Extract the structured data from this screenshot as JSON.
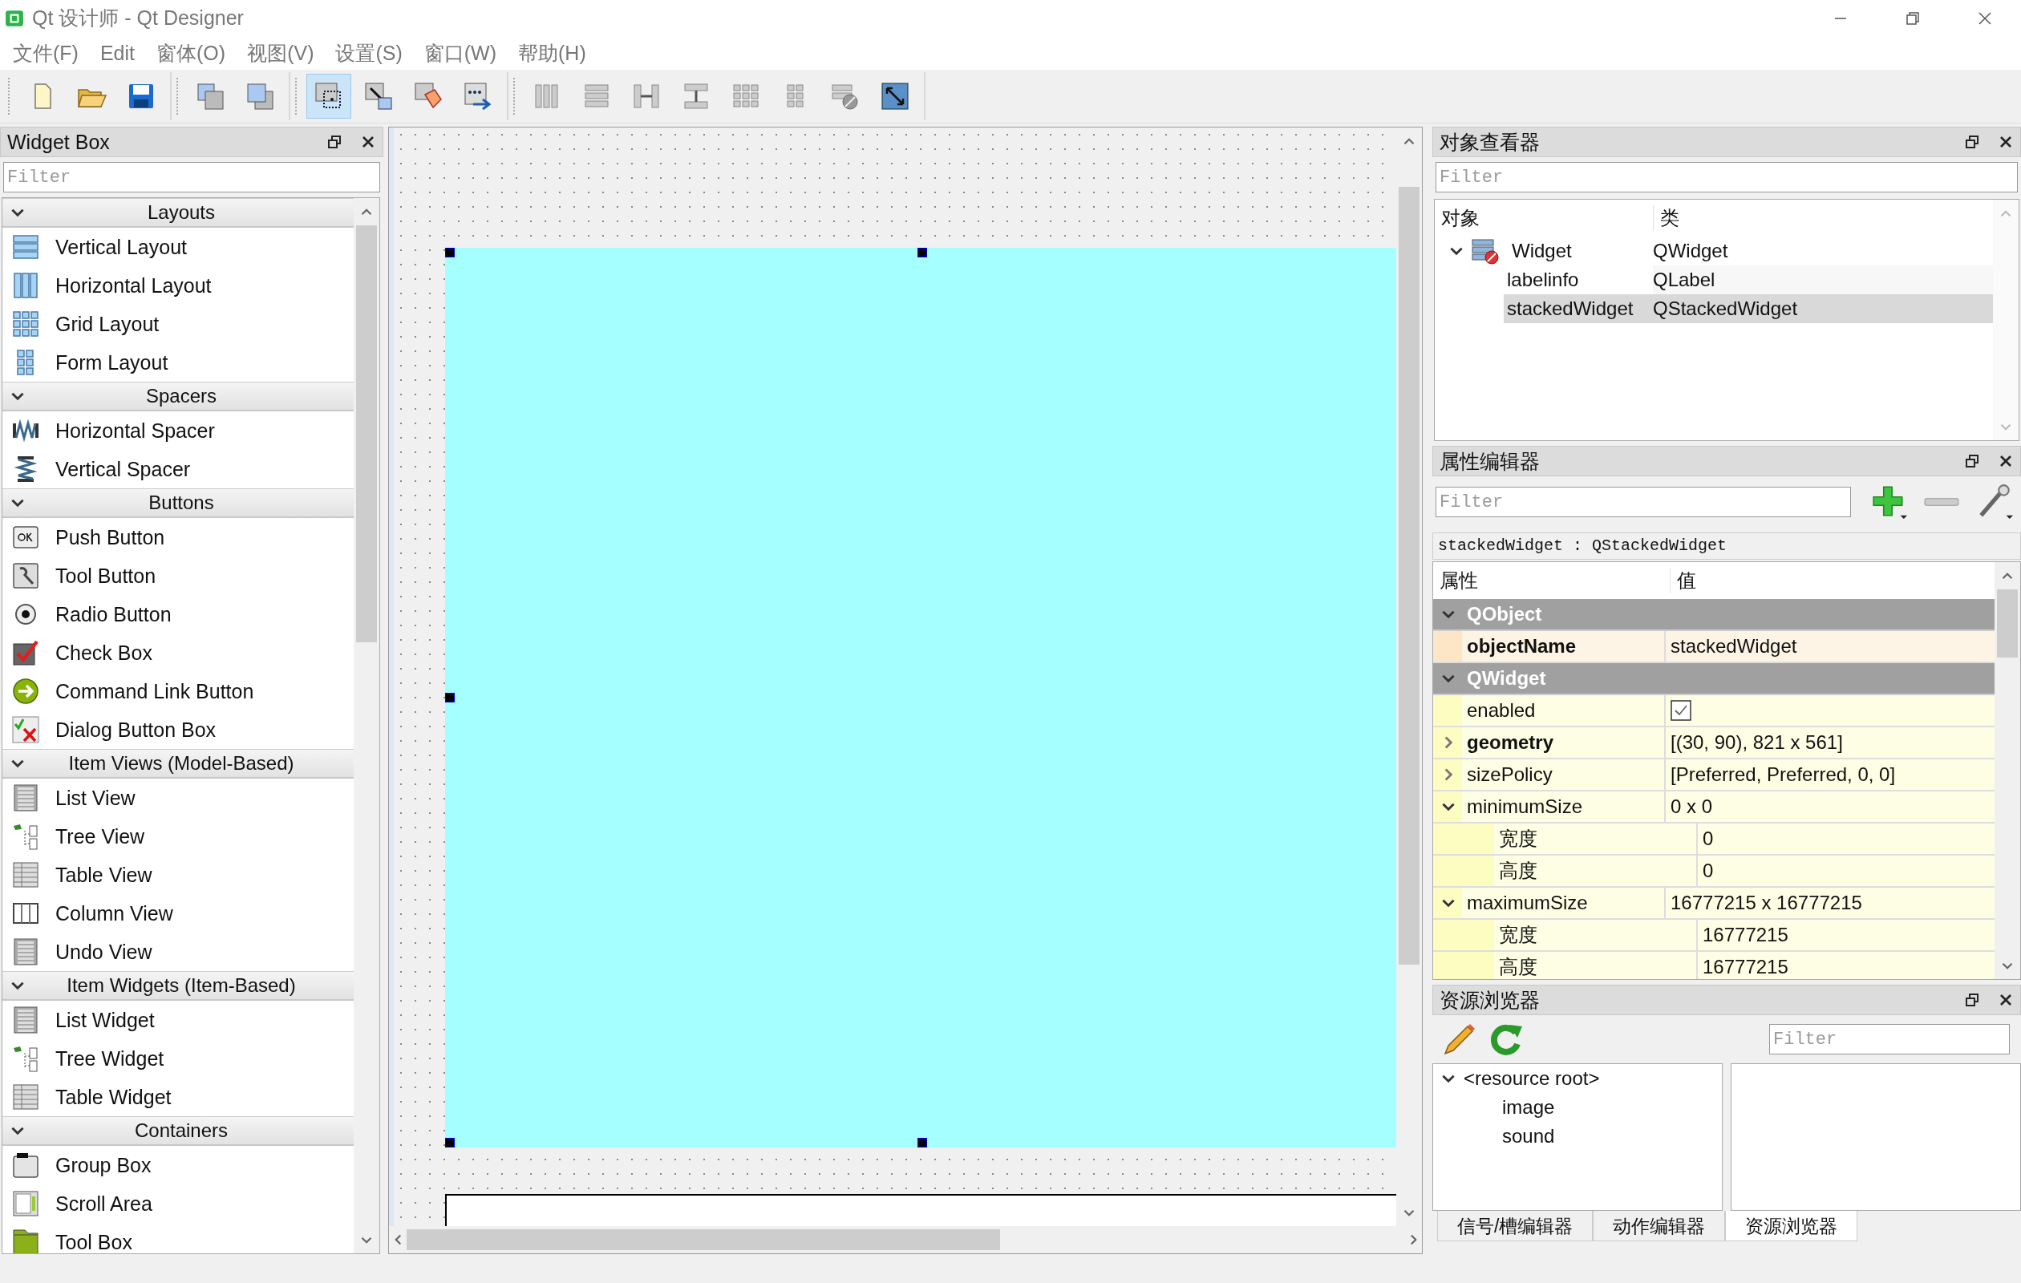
{
  "window": {
    "title": "Qt 设计师 - Qt Designer"
  },
  "menu": [
    "文件(F)",
    "Edit",
    "窗体(O)",
    "视图(V)",
    "设置(S)",
    "窗口(W)",
    "帮助(H)"
  ],
  "toolbar": {
    "groups": [
      {
        "buttons": [
          {
            "kind": "new",
            "selected": false
          },
          {
            "kind": "open",
            "selected": false
          },
          {
            "kind": "save",
            "selected": false
          }
        ]
      },
      {
        "buttons": [
          {
            "kind": "front",
            "selected": false
          },
          {
            "kind": "back",
            "selected": false
          }
        ]
      },
      {
        "buttons": [
          {
            "kind": "editwidgets",
            "selected": true
          },
          {
            "kind": "signals",
            "selected": false
          },
          {
            "kind": "buddy",
            "selected": false
          },
          {
            "kind": "taborder",
            "selected": false
          }
        ]
      },
      {
        "buttons": [
          {
            "kind": "hlayout",
            "selected": false
          },
          {
            "kind": "vlayout",
            "selected": false
          },
          {
            "kind": "hsplit",
            "selected": false
          },
          {
            "kind": "vsplit",
            "selected": false
          },
          {
            "kind": "grid",
            "selected": false
          },
          {
            "kind": "form",
            "selected": false
          },
          {
            "kind": "breaklayout",
            "selected": false
          },
          {
            "kind": "adjust",
            "selected": false
          }
        ]
      }
    ]
  },
  "widget_box": {
    "title": "Widget Box",
    "filter_placeholder": "Filter",
    "categories": [
      {
        "title": "Layouts",
        "expanded": true,
        "items": [
          {
            "label": "Vertical Layout",
            "kind": "vlayout"
          },
          {
            "label": "Horizontal Layout",
            "kind": "hlayout"
          },
          {
            "label": "Grid Layout",
            "kind": "grid"
          },
          {
            "label": "Form Layout",
            "kind": "form"
          }
        ]
      },
      {
        "title": "Spacers",
        "expanded": true,
        "items": [
          {
            "label": "Horizontal Spacer",
            "kind": "hspacer"
          },
          {
            "label": "Vertical Spacer",
            "kind": "vspacer"
          }
        ]
      },
      {
        "title": "Buttons",
        "expanded": true,
        "items": [
          {
            "label": "Push Button",
            "kind": "pushbutton"
          },
          {
            "label": "Tool Button",
            "kind": "toolbutton"
          },
          {
            "label": "Radio Button",
            "kind": "radio"
          },
          {
            "label": "Check Box",
            "kind": "checkbox"
          },
          {
            "label": "Command Link Button",
            "kind": "commandlink"
          },
          {
            "label": "Dialog Button Box",
            "kind": "dialogbuttons"
          }
        ]
      },
      {
        "title": "Item Views (Model-Based)",
        "expanded": true,
        "items": [
          {
            "label": "List View",
            "kind": "list"
          },
          {
            "label": "Tree View",
            "kind": "tree"
          },
          {
            "label": "Table View",
            "kind": "table"
          },
          {
            "label": "Column View",
            "kind": "column"
          },
          {
            "label": "Undo View",
            "kind": "list"
          }
        ]
      },
      {
        "title": "Item Widgets (Item-Based)",
        "expanded": true,
        "items": [
          {
            "label": "List Widget",
            "kind": "list"
          },
          {
            "label": "Tree Widget",
            "kind": "tree"
          },
          {
            "label": "Table Widget",
            "kind": "table"
          }
        ]
      },
      {
        "title": "Containers",
        "expanded": true,
        "items": [
          {
            "label": "Group Box",
            "kind": "group"
          },
          {
            "label": "Scroll Area",
            "kind": "scroll"
          },
          {
            "label": "Tool Box",
            "kind": "toolbox"
          }
        ]
      }
    ]
  },
  "object_inspector": {
    "title": "对象查看器",
    "filter_placeholder": "Filter",
    "columns": [
      "对象",
      "类"
    ],
    "objects": [
      {
        "name": "Widget",
        "class": "QWidget",
        "expanded": true,
        "selected": false,
        "children": [
          {
            "name": "labelinfo",
            "class": "QLabel",
            "selected": false
          },
          {
            "name": "stackedWidget",
            "class": "QStackedWidget",
            "selected": true
          }
        ]
      }
    ]
  },
  "property_editor": {
    "title": "属性编辑器",
    "filter_placeholder": "Filter",
    "object_line": "stackedWidget : QStackedWidget",
    "columns": [
      "属性",
      "值"
    ],
    "sections": [
      {
        "title": "QObject",
        "expanded": true,
        "color": "#fde6c6",
        "properties": [
          {
            "name": "objectName",
            "value": "stackedWidget",
            "bold": true
          }
        ]
      },
      {
        "title": "QWidget",
        "expanded": true,
        "color": "#fdfdc2",
        "properties": [
          {
            "name": "enabled",
            "kind": "bool",
            "checked": true,
            "bold": false
          },
          {
            "name": "geometry",
            "value": "[(30, 90), 821 x 561]",
            "bold": true,
            "expanded": false
          },
          {
            "name": "sizePolicy",
            "value": "[Preferred, Preferred, 0, 0]",
            "bold": false,
            "expanded": false
          },
          {
            "name": "minimumSize",
            "value": "0 x 0",
            "bold": false,
            "expanded": true,
            "children": [
              {
                "name": "宽度",
                "value": "0",
                "bold": false
              },
              {
                "name": "高度",
                "value": "0",
                "bold": false
              }
            ]
          },
          {
            "name": "maximumSize",
            "value": "16777215 x 16777215",
            "bold": false,
            "expanded": true,
            "children": [
              {
                "name": "宽度",
                "value": "16777215",
                "bold": false
              },
              {
                "name": "高度",
                "value": "16777215",
                "bold": false
              }
            ]
          }
        ]
      }
    ]
  },
  "resource_browser": {
    "title": "资源浏览器",
    "filter_placeholder": "Filter",
    "tree": [
      {
        "label": "<resource root>",
        "expanded": true,
        "children": [
          {
            "label": "image"
          },
          {
            "label": "sound"
          }
        ]
      }
    ]
  },
  "bottom_tabs": [
    {
      "label": "信号/槽编辑器",
      "selected": false
    },
    {
      "label": "动作编辑器",
      "selected": false
    },
    {
      "label": "资源浏览器",
      "selected": true
    }
  ]
}
